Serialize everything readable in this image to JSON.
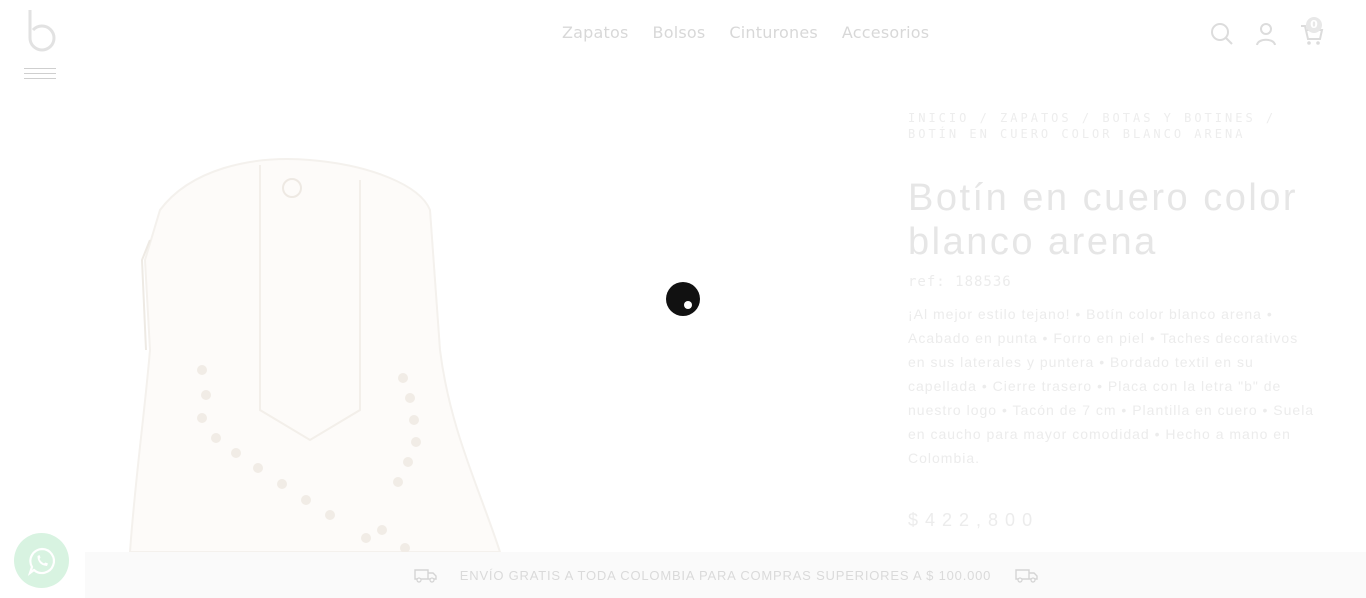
{
  "header": {
    "nav": [
      "Zapatos",
      "Bolsos",
      "Cinturones",
      "Accesorios"
    ],
    "cart_count": "0"
  },
  "product": {
    "breadcrumb": [
      "INICIO",
      "ZAPATOS",
      "BOTAS Y BOTINES",
      "BOTÍN EN CUERO COLOR BLANCO ARENA"
    ],
    "title": "Botín en cuero color blanco arena",
    "ref": "ref: 188536",
    "description": "¡Al mejor estilo tejano! • Botín color blanco arena • Acabado en punta • Forro en piel • Taches decorativos en sus laterales y puntera • Bordado textil en su capellada • Cierre trasero • Placa con la letra \"b\" de nuestro logo • Tacón de 7 cm • Plantilla en cuero • Suela en caucho para mayor comodidad • Hecho a mano en Colombia.",
    "price": "$422,800"
  },
  "banner": {
    "text": "ENVÍO GRATIS A TODA COLOMBIA PARA COMPRAS SUPERIORES A $ 100.000"
  },
  "icons": {
    "logo": "logo-b-icon",
    "menu": "hamburger-icon",
    "search": "search-icon",
    "account": "user-icon",
    "cart": "cart-icon",
    "truck": "truck-icon",
    "whatsapp": "whatsapp-icon"
  },
  "colors": {
    "loader": "#111111",
    "whatsapp": "#d8f3e1",
    "banner_bg": "#fafafa"
  }
}
